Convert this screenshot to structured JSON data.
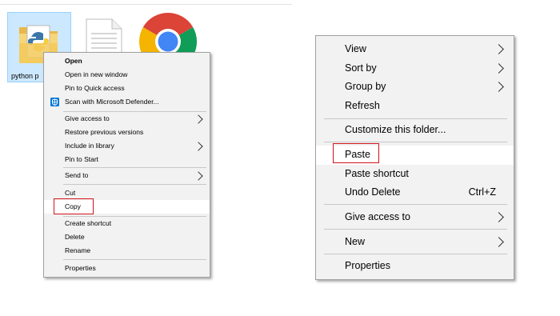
{
  "desktop": {
    "file_label": "python p"
  },
  "left_menu": {
    "items": [
      {
        "label": "Open",
        "bold": true
      },
      {
        "label": "Open in new window"
      },
      {
        "label": "Pin to Quick access"
      },
      {
        "label": "Scan with Microsoft Defender..."
      },
      {
        "label": "Give access to"
      },
      {
        "label": "Restore previous versions"
      },
      {
        "label": "Include in library"
      },
      {
        "label": "Pin to Start"
      },
      {
        "label": "Send to"
      },
      {
        "label": "Cut"
      },
      {
        "label": "Copy"
      },
      {
        "label": "Create shortcut"
      },
      {
        "label": "Delete"
      },
      {
        "label": "Rename"
      },
      {
        "label": "Properties"
      }
    ]
  },
  "right_menu": {
    "items": [
      {
        "label": "View"
      },
      {
        "label": "Sort by"
      },
      {
        "label": "Group by"
      },
      {
        "label": "Refresh"
      },
      {
        "label": "Customize this folder..."
      },
      {
        "label": "Paste"
      },
      {
        "label": "Paste shortcut"
      },
      {
        "label": "Undo Delete",
        "shortcut": "Ctrl+Z"
      },
      {
        "label": "Give access to"
      },
      {
        "label": "New"
      },
      {
        "label": "Properties"
      }
    ]
  },
  "colors": {
    "highlight_box": "#d2141c",
    "selection": "#cce8ff",
    "defender_blue": "#0078d7",
    "chrome_red": "#db4437",
    "chrome_yellow": "#f4b400",
    "chrome_green": "#0f9d58",
    "chrome_blue": "#4285f4"
  }
}
